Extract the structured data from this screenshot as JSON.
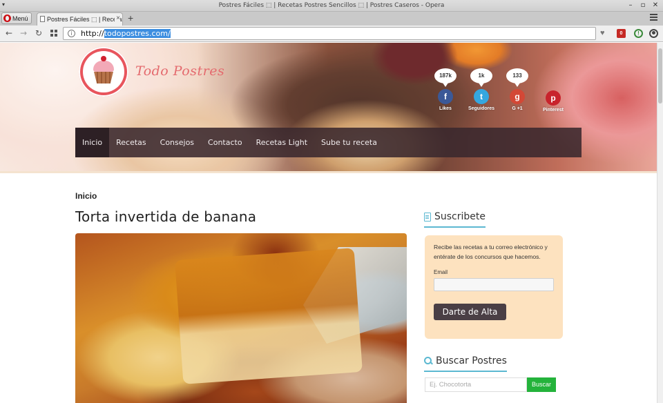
{
  "window": {
    "title": "Postres Fáciles ⬚ | Recetas Postres Sencillos ⬚ | Postres Caseros - Opera"
  },
  "browser": {
    "menu_label": "Menú",
    "tab_title": "Postres Fáciles ⬚ | Recetas Postres",
    "new_tab": "+",
    "url_prefix": "http://",
    "url_selected": "todopostres.com/",
    "ext_badge": "0"
  },
  "site": {
    "name": "Todo Postres",
    "social": [
      {
        "count": "187k",
        "glyph": "f",
        "label": "Likes",
        "color": "#3b5998"
      },
      {
        "count": "1k",
        "glyph": "t",
        "label": "Seguidores",
        "color": "#35a7e0"
      },
      {
        "count": "133",
        "glyph": "g",
        "label": "G +1",
        "color": "#d34836"
      },
      {
        "glyph": "p",
        "label": "Pinterest",
        "color": "#c8232c"
      }
    ],
    "nav": [
      "Inicio",
      "Recetas",
      "Consejos",
      "Contacto",
      "Recetas Light",
      "Sube tu receta"
    ]
  },
  "content": {
    "breadcrumb": "Inicio",
    "post_title": "Torta invertida de banana"
  },
  "sidebar": {
    "subscribe_title": "Suscribete",
    "subscribe_text": "Recibe las recetas a tu correo electrónico y entérate de los concursos que hacemos.",
    "email_label": "Email",
    "subscribe_button": "Darte de Alta",
    "search_title": "Buscar Postres",
    "search_placeholder": "Ej. Chocotorta",
    "search_button": "Buscar"
  }
}
